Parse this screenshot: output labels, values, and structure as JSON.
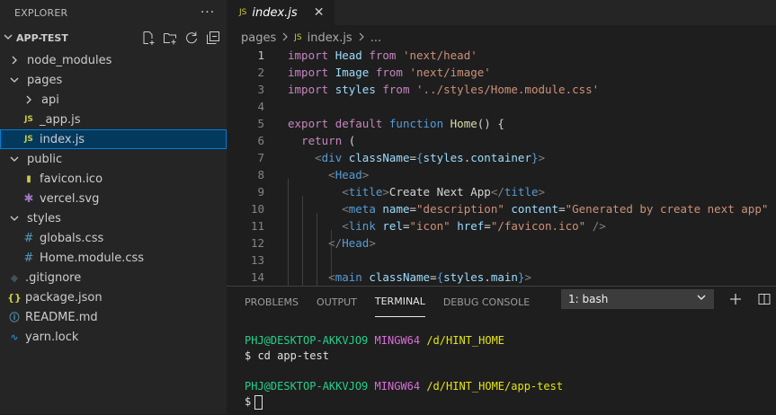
{
  "sidebar": {
    "header": "EXPLORER",
    "more": "···",
    "project": "APP-TEST",
    "items": [
      {
        "label": "node_modules",
        "type": "folder-closed",
        "indent": 0
      },
      {
        "label": "pages",
        "type": "folder-open",
        "indent": 0
      },
      {
        "label": "api",
        "type": "folder-closed",
        "indent": 1
      },
      {
        "label": "_app.js",
        "type": "js",
        "indent": 1
      },
      {
        "label": "index.js",
        "type": "js",
        "indent": 1,
        "selected": true
      },
      {
        "label": "public",
        "type": "folder-open",
        "indent": 0
      },
      {
        "label": "favicon.ico",
        "type": "ico",
        "indent": 1
      },
      {
        "label": "vercel.svg",
        "type": "svg",
        "indent": 1
      },
      {
        "label": "styles",
        "type": "folder-open",
        "indent": 0
      },
      {
        "label": "globals.css",
        "type": "css",
        "indent": 1
      },
      {
        "label": "Home.module.css",
        "type": "css",
        "indent": 1
      },
      {
        "label": ".gitignore",
        "type": "git",
        "indent": 0
      },
      {
        "label": "package.json",
        "type": "json",
        "indent": 0
      },
      {
        "label": "README.md",
        "type": "info",
        "indent": 0
      },
      {
        "label": "yarn.lock",
        "type": "yarn",
        "indent": 0
      }
    ]
  },
  "editor": {
    "tab": {
      "icon": "JS",
      "label": "index.js",
      "close": "✕"
    },
    "breadcrumb": {
      "folder": "pages",
      "file": "index.js",
      "more": "..."
    },
    "lines": [
      {
        "n": "1",
        "active": true,
        "tokens": [
          [
            "kw",
            "import "
          ],
          [
            "var",
            "Head "
          ],
          [
            "kw",
            "from "
          ],
          [
            "str",
            "'next/head'"
          ]
        ]
      },
      {
        "n": "2",
        "tokens": [
          [
            "kw",
            "import "
          ],
          [
            "var",
            "Image "
          ],
          [
            "kw",
            "from "
          ],
          [
            "str",
            "'next/image'"
          ]
        ]
      },
      {
        "n": "3",
        "tokens": [
          [
            "kw",
            "import "
          ],
          [
            "var",
            "styles "
          ],
          [
            "kw",
            "from "
          ],
          [
            "str",
            "'../styles/Home.module.css'"
          ]
        ]
      },
      {
        "n": "4",
        "tokens": []
      },
      {
        "n": "5",
        "tokens": [
          [
            "kw",
            "export "
          ],
          [
            "kw",
            "default "
          ],
          [
            "bl",
            "function "
          ],
          [
            "fn",
            "Home"
          ],
          [
            "txt",
            "() {"
          ]
        ]
      },
      {
        "n": "6",
        "tokens": [
          [
            "txt",
            "  "
          ],
          [
            "kw",
            "return "
          ],
          [
            "txt",
            "("
          ]
        ]
      },
      {
        "n": "7",
        "tokens": [
          [
            "txt",
            "    "
          ],
          [
            "tagc",
            "<"
          ],
          [
            "bl",
            "div "
          ],
          [
            "var",
            "className"
          ],
          [
            "txt",
            "="
          ],
          [
            "bl",
            "{"
          ],
          [
            "var",
            "styles"
          ],
          [
            "txt",
            "."
          ],
          [
            "var",
            "container"
          ],
          [
            "bl",
            "}"
          ],
          [
            "tagc",
            ">"
          ]
        ]
      },
      {
        "n": "8",
        "tokens": [
          [
            "txt",
            "      "
          ],
          [
            "tagc",
            "<"
          ],
          [
            "bl",
            "Head"
          ],
          [
            "tagc",
            ">"
          ]
        ]
      },
      {
        "n": "9",
        "tokens": [
          [
            "txt",
            "        "
          ],
          [
            "tagc",
            "<"
          ],
          [
            "bl",
            "title"
          ],
          [
            "tagc",
            ">"
          ],
          [
            "txt",
            "Create Next App"
          ],
          [
            "tagc",
            "</"
          ],
          [
            "bl",
            "title"
          ],
          [
            "tagc",
            ">"
          ]
        ]
      },
      {
        "n": "10",
        "tokens": [
          [
            "txt",
            "        "
          ],
          [
            "tagc",
            "<"
          ],
          [
            "bl",
            "meta "
          ],
          [
            "var",
            "name"
          ],
          [
            "txt",
            "="
          ],
          [
            "str",
            "\"description\" "
          ],
          [
            "var",
            "content"
          ],
          [
            "txt",
            "="
          ],
          [
            "str",
            "\"Generated by create next app\""
          ]
        ]
      },
      {
        "n": "11",
        "tokens": [
          [
            "txt",
            "        "
          ],
          [
            "tagc",
            "<"
          ],
          [
            "bl",
            "link "
          ],
          [
            "var",
            "rel"
          ],
          [
            "txt",
            "="
          ],
          [
            "str",
            "\"icon\" "
          ],
          [
            "var",
            "href"
          ],
          [
            "txt",
            "="
          ],
          [
            "str",
            "\"/favicon.ico\" "
          ],
          [
            "tagc",
            "/>"
          ]
        ]
      },
      {
        "n": "12",
        "tokens": [
          [
            "txt",
            "      "
          ],
          [
            "tagc",
            "</"
          ],
          [
            "bl",
            "Head"
          ],
          [
            "tagc",
            ">"
          ]
        ]
      },
      {
        "n": "13",
        "tokens": []
      },
      {
        "n": "14",
        "tokens": [
          [
            "txt",
            "      "
          ],
          [
            "tagc",
            "<"
          ],
          [
            "bl",
            "main "
          ],
          [
            "var",
            "className"
          ],
          [
            "txt",
            "="
          ],
          [
            "bl",
            "{"
          ],
          [
            "var",
            "styles"
          ],
          [
            "txt",
            "."
          ],
          [
            "var",
            "main"
          ],
          [
            "bl",
            "}"
          ],
          [
            "tagc",
            ">"
          ]
        ]
      }
    ]
  },
  "panel": {
    "tabs": [
      "PROBLEMS",
      "OUTPUT",
      "TERMINAL",
      "DEBUG CONSOLE"
    ],
    "active_tab": "TERMINAL",
    "terminal_select": "1: bash",
    "terminal": [
      {
        "user": "PHJ@DESKTOP-AKKVJO9",
        "sys": "MINGW64",
        "path": "/d/HINT_HOME"
      },
      {
        "cmd": "$ cd app-test"
      },
      {
        "blank": true
      },
      {
        "user": "PHJ@DESKTOP-AKKVJO9",
        "sys": "MINGW64",
        "path": "/d/HINT_HOME/app-test"
      },
      {
        "prompt": "$"
      }
    ]
  },
  "colors": {
    "sidebar_bg": "#252526",
    "editor_bg": "#1e1e1e",
    "selection": "#04395e",
    "focus_border": "#007fd4"
  }
}
